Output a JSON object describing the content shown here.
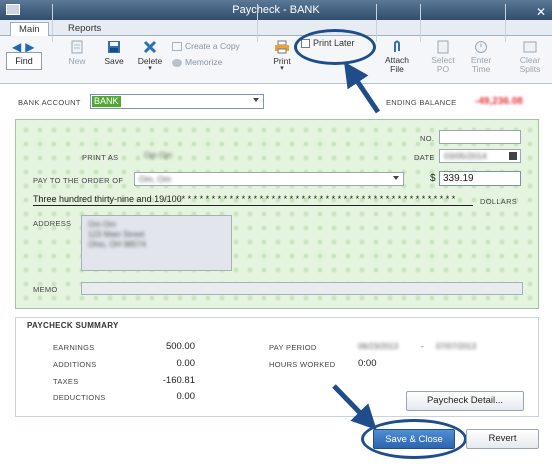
{
  "window": {
    "title": "Paycheck - BANK"
  },
  "tabs": [
    {
      "label": "Main"
    },
    {
      "label": "Reports"
    }
  ],
  "toolbar": {
    "find_label": "Find",
    "new_label": "New",
    "save_label": "Save",
    "delete_label": "Delete",
    "create_copy_label": "Create a Copy",
    "memorize_label": "Memorize",
    "print_label": "Print",
    "print_later_label": "Print Later",
    "attach_file_label": "Attach File",
    "select_po_label": "Select PO",
    "enter_time_label": "Enter Time",
    "clear_splits_label": "Clear Splits"
  },
  "account": {
    "label": "BANK ACCOUNT",
    "value": "BANK",
    "ending_balance_label": "ENDING BALANCE",
    "ending_balance_value": "-49,236.08"
  },
  "check": {
    "no_label": "NO.",
    "no_value": "",
    "print_as_label": "PRINT AS",
    "print_as_value": "Om Om",
    "date_label": "DATE",
    "date_value": "03/05/2014",
    "pay_to_label": "PAY TO THE ORDER OF",
    "pay_to_value": "Om, Om",
    "currency_symbol": "$",
    "amount": "339.19",
    "written_amount": "Three hundred thirty-nine and 19/100* * * * * * * * * * * * * * * * * * * * * * * * * * * * * * * * * * * * * * * * * * * * * *",
    "dollars_label": "DOLLARS",
    "address_label": "ADDRESS",
    "address_lines": [
      "Om Om",
      "123 Main Street",
      "Ohio, OH 98574"
    ],
    "memo_label": "MEMO",
    "memo_value": ""
  },
  "summary": {
    "title": "PAYCHECK SUMMARY",
    "earnings_label": "EARNINGS",
    "earnings_value": "500.00",
    "additions_label": "ADDITIONS",
    "additions_value": "0.00",
    "taxes_label": "TAXES",
    "taxes_value": "-160.81",
    "deductions_label": "DEDUCTIONS",
    "deductions_value": "0.00",
    "pay_period_label": "PAY PERIOD",
    "pay_period_start": "06/23/2013",
    "pay_period_dash": "-",
    "pay_period_end": "07/07/2013",
    "hours_worked_label": "HOURS WORKED",
    "hours_worked_value": "0:00",
    "detail_button_label": "Paycheck Detail..."
  },
  "footer": {
    "save_close_label": "Save & Close",
    "revert_label": "Revert"
  },
  "colors": {
    "accent": "#2d64ae",
    "check_bg": "#e5f4de",
    "ending_balance": "#e8303c",
    "callout": "#1e4d8a"
  },
  "icons": [
    "window-icon",
    "close-icon",
    "prev-arrow-icon",
    "next-arrow-icon",
    "new-doc-icon",
    "save-icon",
    "delete-icon",
    "copy-icon",
    "memorize-icon",
    "printer-icon",
    "paperclip-icon",
    "select-po-icon",
    "enter-time-icon",
    "clear-splits-icon",
    "calendar-icon"
  ]
}
